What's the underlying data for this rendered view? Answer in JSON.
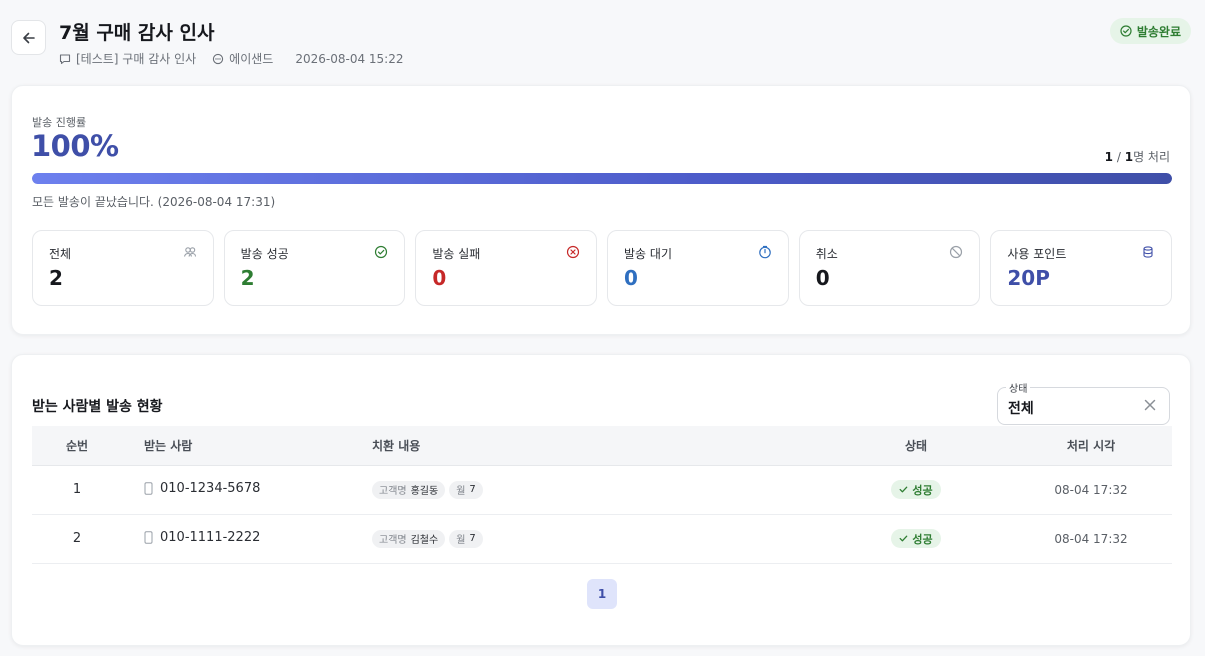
{
  "header": {
    "title": "7월 구매 감사 인사",
    "template": "[테스트] 구매 감사 인사",
    "channel": "에이샌드",
    "datetime": "2026-08-04 15:22",
    "status": "발송완료"
  },
  "progress": {
    "label": "발송 진행률",
    "percent_text": "100%",
    "percent": 100,
    "done": "1",
    "total": "1",
    "count_suffix": "명 처리",
    "note": "모든 발송이 끝났습니다. (2026-08-04 17:31)"
  },
  "stats": [
    {
      "label": "전체",
      "value": "2",
      "icon": "users-icon",
      "color": "#16181d"
    },
    {
      "label": "발송 성공",
      "value": "2",
      "icon": "check-circle-icon",
      "color": "#2e7d32"
    },
    {
      "label": "발송 실패",
      "value": "0",
      "icon": "x-circle-icon",
      "color": "#c62828"
    },
    {
      "label": "발송 대기",
      "value": "0",
      "icon": "timer-icon",
      "color": "#2f6fc0"
    },
    {
      "label": "취소",
      "value": "0",
      "icon": "ban-icon",
      "color": "#16181d"
    },
    {
      "label": "사용 포인트",
      "value": "20P",
      "icon": "database-icon",
      "color": "#3f4fa8"
    }
  ],
  "recipients": {
    "title": "받는 사람별 발송 현황",
    "filter": {
      "label": "상태",
      "value": "전체"
    },
    "columns": [
      "순번",
      "받는 사람",
      "치환 내용",
      "상태",
      "처리 시각"
    ],
    "rows": [
      {
        "seq": "1",
        "phone": "010-1234-5678",
        "vars": [
          {
            "key": "고객명",
            "value": "홍길동"
          },
          {
            "key": "월",
            "value": "7"
          }
        ],
        "status": "성공",
        "time": "08-04 17:32"
      },
      {
        "seq": "2",
        "phone": "010-1111-2222",
        "vars": [
          {
            "key": "고객명",
            "value": "김철수"
          },
          {
            "key": "월",
            "value": "7"
          }
        ],
        "status": "성공",
        "time": "08-04 17:32"
      }
    ],
    "page": "1"
  }
}
